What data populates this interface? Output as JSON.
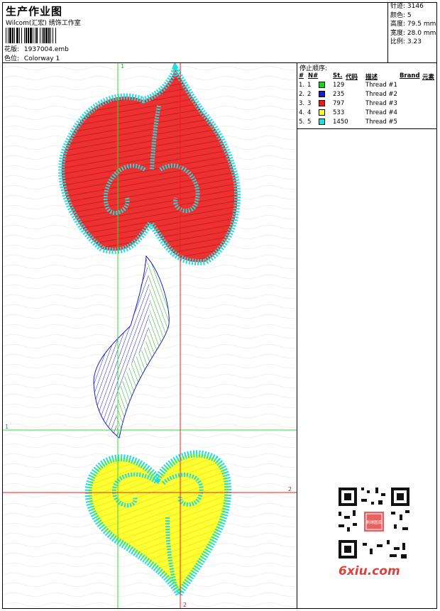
{
  "header": {
    "title": "生产作业图",
    "company": "Wilcom(汇宏) 绣饰工作室",
    "design_label": "花版:",
    "design_value": "1937004.emb",
    "colorway_label": "色位:",
    "colorway_value": "Colorway 1"
  },
  "stats": [
    {
      "label": "针迹:",
      "value": "3146"
    },
    {
      "label": "颜色:",
      "value": "5"
    },
    {
      "label": "高度:",
      "value": "79.5 mm"
    },
    {
      "label": "宽度:",
      "value": "28.0 mm"
    },
    {
      "label": "比例:",
      "value": "3.23"
    }
  ],
  "sequence": {
    "title": "停止顺序:",
    "headers": {
      "num": "#",
      "n": "N#",
      "st": "St.",
      "code": "代码",
      "desc": "描述",
      "brand": "Brand",
      "element": "元素"
    },
    "rows": [
      {
        "num": "1.",
        "n": "1",
        "color": "#22cc22",
        "st": "129",
        "desc": "Thread #1"
      },
      {
        "num": "2.",
        "n": "2",
        "color": "#1a1acc",
        "st": "235",
        "desc": "Thread #2"
      },
      {
        "num": "3.",
        "n": "3",
        "color": "#e02020",
        "st": "797",
        "desc": "Thread #3"
      },
      {
        "num": "4.",
        "n": "4",
        "color": "#ffff22",
        "st": "533",
        "desc": "Thread #4"
      },
      {
        "num": "5.",
        "n": "5",
        "color": "#22dddd",
        "st": "1450",
        "desc": "Thread #5"
      }
    ]
  },
  "guides": {
    "green_v": "1",
    "green_h": "1",
    "red_h": "2",
    "red_v": "2"
  },
  "watermark": "6xiu.com",
  "qr_text": "刺绣图库",
  "colors": {
    "green": "#22cc22",
    "blue": "#1a1acc",
    "red": "#e02020",
    "yellow": "#ffff22",
    "cyan": "#22dddd"
  }
}
